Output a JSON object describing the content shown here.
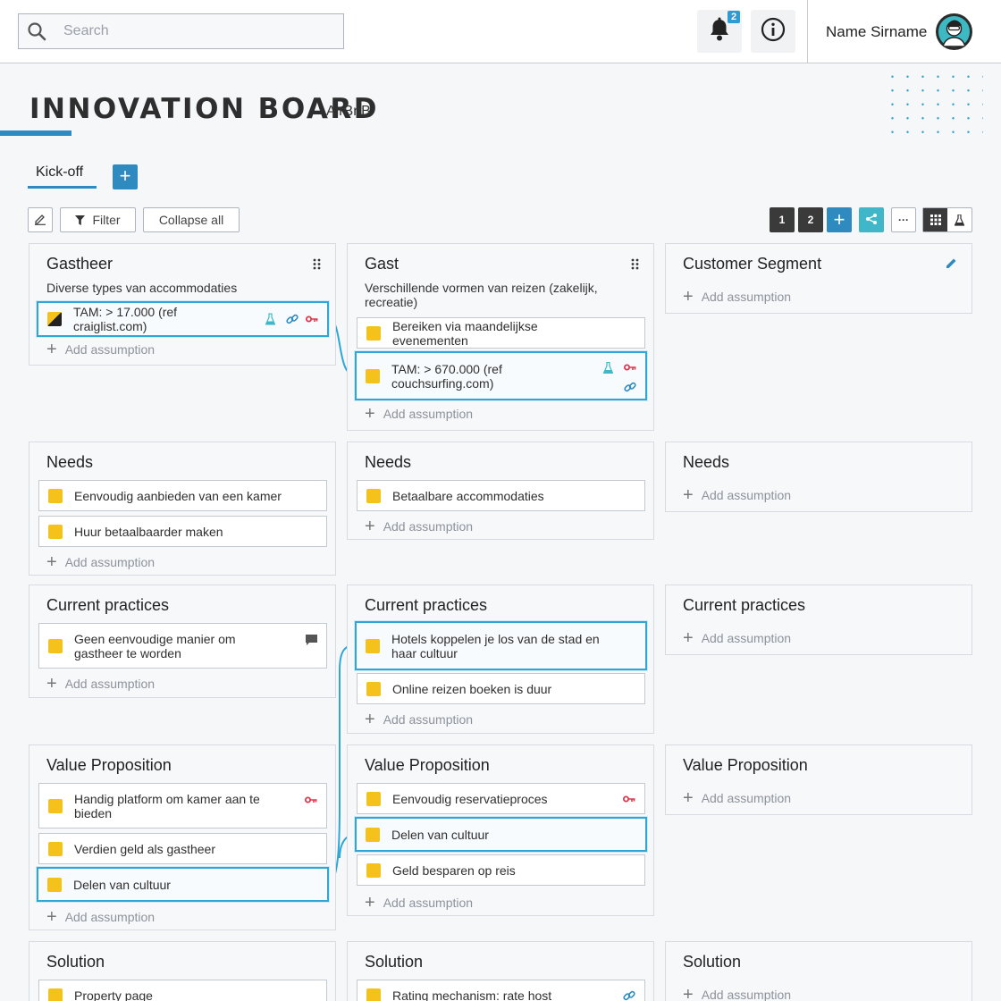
{
  "search": {
    "placeholder": "Search"
  },
  "notifications": {
    "count": "2"
  },
  "user": {
    "name": "Name Sirname"
  },
  "board": {
    "title": "INNOVATION BOARD",
    "subtitle": "AirBnB"
  },
  "tabs": [
    {
      "label": "Kick-off"
    }
  ],
  "toolbar": {
    "filter_label": "Filter",
    "collapse_label": "Collapse all",
    "view_1": "1",
    "view_2": "2",
    "more": "···"
  },
  "add_assumption_label": "Add assumption",
  "columns": [
    {
      "segment": {
        "title": "Gastheer",
        "desc": "Diverse types van accommodaties",
        "items": [
          {
            "text": "TAM: > 17.000 (ref craiglist.com)"
          }
        ]
      },
      "needs": {
        "title": "Needs",
        "items": [
          {
            "text": "Eenvoudig aanbieden van een kamer"
          },
          {
            "text": "Huur betaalbaarder maken"
          }
        ]
      },
      "practices": {
        "title": "Current practices",
        "items": [
          {
            "text": "Geen eenvoudige manier om gastheer te worden"
          }
        ]
      },
      "value": {
        "title": "Value Proposition",
        "items": [
          {
            "text": "Handig platform om kamer aan te bieden"
          },
          {
            "text": "Verdien geld als gastheer"
          },
          {
            "text": "Delen van cultuur"
          }
        ]
      },
      "solution": {
        "title": "Solution",
        "items": [
          {
            "text": "Property page"
          }
        ]
      }
    },
    {
      "segment": {
        "title": "Gast",
        "desc": "Verschillende vormen van reizen (zakelijk, recreatie)",
        "items": [
          {
            "text": "Bereiken via maandelijkse evenementen"
          },
          {
            "text": "TAM: > 670.000 (ref couchsurfing.com)"
          }
        ]
      },
      "needs": {
        "title": "Needs",
        "items": [
          {
            "text": "Betaalbare accommodaties"
          }
        ]
      },
      "practices": {
        "title": "Current practices",
        "items": [
          {
            "text": "Hotels koppelen je los van de stad en haar cultuur"
          },
          {
            "text": "Online reizen boeken is duur"
          }
        ]
      },
      "value": {
        "title": "Value Proposition",
        "items": [
          {
            "text": "Eenvoudig reservatieproces"
          },
          {
            "text": "Delen van cultuur"
          },
          {
            "text": "Geld besparen op reis"
          }
        ]
      },
      "solution": {
        "title": "Solution",
        "items": [
          {
            "text": "Rating mechanism: rate host"
          }
        ]
      }
    },
    {
      "segment": {
        "title": "Customer Segment"
      },
      "needs": {
        "title": "Needs"
      },
      "practices": {
        "title": "Current practices"
      },
      "value": {
        "title": "Value Proposition"
      },
      "solution": {
        "title": "Solution"
      }
    }
  ],
  "colors": {
    "accent": "#2f8bbf",
    "selection": "#2fa6d6",
    "sticky": "#f5c21b",
    "key": "#e0364d",
    "teal": "#3fb7c8"
  }
}
